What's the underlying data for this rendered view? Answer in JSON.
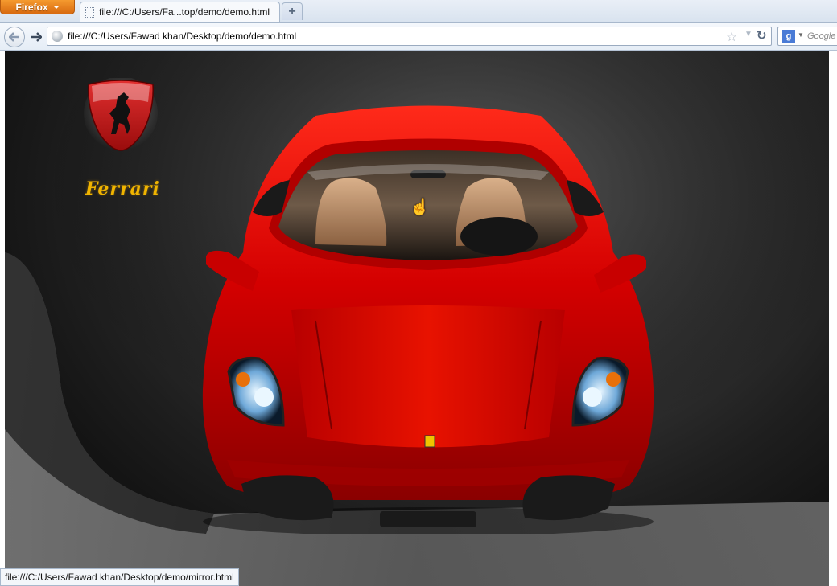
{
  "browser": {
    "app_menu_label": "Firefox",
    "tab_title": "file:///C:/Users/Fa...top/demo/demo.html",
    "new_tab_label": "+",
    "url": "file:///C:/Users/Fawad khan/Desktop/demo/demo.html",
    "search_placeholder": "Google",
    "status_link": "file:///C:/Users/Fawad khan/Desktop/demo/mirror.html"
  },
  "page": {
    "brand_name": "Ferrari",
    "brand_color": "#f0b400",
    "car_color": "#d40000",
    "background_color": "#1e1e1e"
  },
  "icons": {
    "back": "back-arrow-icon",
    "forward": "forward-arrow-icon",
    "site": "globe-icon",
    "bookmark": "star-icon",
    "history": "chevron-down-icon",
    "reload": "reload-icon",
    "search_engine": "google-icon",
    "cursor": "hand-cursor-icon"
  }
}
